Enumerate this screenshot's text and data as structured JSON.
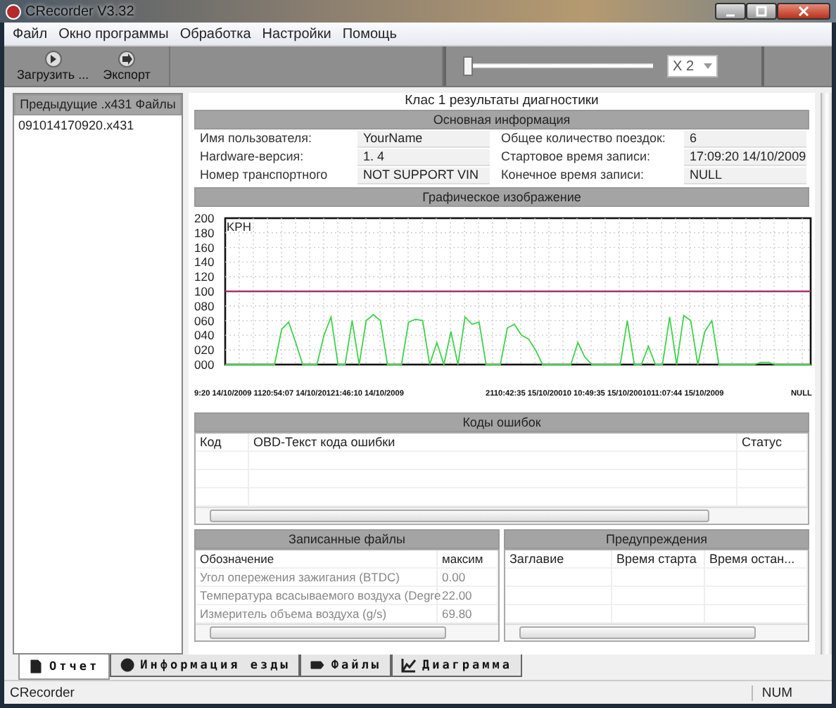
{
  "window": {
    "title": "CRecorder V3.32"
  },
  "menu": [
    "Файл",
    "Окно программы",
    "Обработка",
    "Настройки",
    "Помощь"
  ],
  "toolbar": {
    "buttons": [
      "Загрузить ...",
      "Экспорт"
    ],
    "speed_slider": {
      "level": 0.0
    },
    "speed_select": {
      "value": "X 2"
    }
  },
  "sidebar": {
    "title": "Предыдущие .x431 Файлы",
    "files": [
      "091014170920.x431"
    ]
  },
  "report": {
    "title": "Клас 1 результаты диагностики",
    "basic_info": {
      "header": "Основная информация",
      "rows": [
        {
          "left": {
            "label": "Имя пользователя:",
            "value": "YourName"
          },
          "right": {
            "label": "Общее количество поездок:",
            "value": "6"
          }
        },
        {
          "left": {
            "label": "Hardware-версия:",
            "value": "1. 4"
          },
          "right": {
            "label": "Стартовое время записи:",
            "value": "17:09:20 14/10/2009"
          }
        },
        {
          "left": {
            "label": "Номер транспортного",
            "value": "NOT SUPPORT VIN"
          },
          "right": {
            "label": "Конечное время записи:",
            "value": "NULL"
          }
        }
      ]
    },
    "graph": {
      "header": "Графическое изображение",
      "chart_data": {
        "type": "line",
        "grid": true,
        "ylabel": "KPH",
        "ylim": [
          0,
          200
        ],
        "yticks": [
          {
            "value": 200,
            "label": "200"
          },
          {
            "value": 180,
            "label": "180"
          },
          {
            "value": 160,
            "label": "160"
          },
          {
            "value": 140,
            "label": "140"
          },
          {
            "value": 120,
            "label": "120"
          },
          {
            "value": 100,
            "label": "100"
          },
          {
            "value": 80,
            "label": "080"
          },
          {
            "value": 60,
            "label": "060"
          },
          {
            "value": 40,
            "label": "040"
          },
          {
            "value": 20,
            "label": "020"
          },
          {
            "value": 0,
            "label": "000"
          }
        ],
        "series": [
          {
            "color": "#3fd24a",
            "values": [
              0,
              0,
              0,
              0,
              0,
              0,
              0,
              0,
              48,
              58,
              30,
              0,
              0,
              0,
              40,
              65,
              0,
              0,
              60,
              0,
              60,
              68,
              60,
              0,
              0,
              0,
              58,
              62,
              60,
              0,
              30,
              0,
              45,
              0,
              65,
              55,
              58,
              0,
              0,
              0,
              50,
              55,
              40,
              35,
              20,
              0,
              0,
              0,
              0,
              0,
              30,
              10,
              0,
              0,
              0,
              0,
              0,
              60,
              0,
              0,
              25,
              0,
              0,
              65,
              0,
              67,
              60,
              0,
              45,
              60,
              0,
              0,
              0,
              0,
              0,
              0,
              3,
              3,
              0,
              0,
              0,
              0,
              0,
              0
            ]
          }
        ],
        "ref_lines": [
          {
            "axis": "y",
            "value": 100,
            "color": "#a8306c"
          }
        ]
      },
      "x_labels": [
        "9:20 14/10/2009 1120:54:07 14/10/20121:46:10 14/10/2009",
        "2110:42:35 15/10/20010 10:49:35 15/10/2001011:07:44 15/10/2009",
        "NULL"
      ]
    },
    "error_codes": {
      "header": "Коды ошибок",
      "columns": [
        "Код",
        "OBD-Текст кода ошибки",
        "Статус"
      ]
    },
    "recorded_files": {
      "header": "Записанные файлы",
      "columns": [
        "Обозначение",
        "максим"
      ],
      "rows": [
        [
          "Угол опережения зажигания (BTDC)",
          "0.00"
        ],
        [
          "Температура всасываемого воздуха (Degre",
          "22.00"
        ],
        [
          "Измеритель объема воздуха (g/s)",
          "69.80"
        ]
      ]
    },
    "warnings": {
      "header": "Предупреждения",
      "columns": [
        "Заглавие",
        "Время старта",
        "Время остан..."
      ]
    }
  },
  "tabs": [
    {
      "label": "Отчет",
      "selected": true
    },
    {
      "label": "Информация езды",
      "selected": false
    },
    {
      "label": "Файлы",
      "selected": false
    },
    {
      "label": "Диаграмма",
      "selected": false
    }
  ],
  "status_bar": {
    "text": "CRecorder",
    "indicator": "NUM"
  }
}
